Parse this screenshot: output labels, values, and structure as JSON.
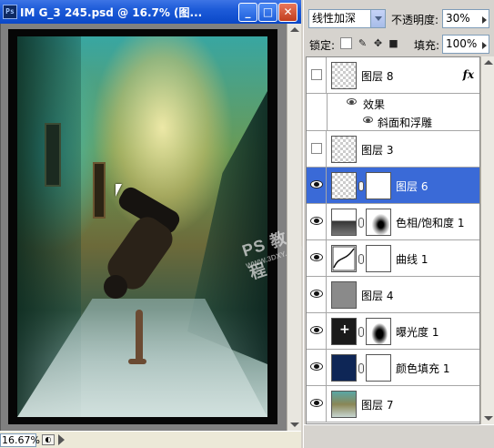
{
  "document": {
    "title": "IM G_3 245.psd @ 16.7% (图...",
    "app_icon": "Ps",
    "buttons": {
      "minimize": "_",
      "maximize": "□",
      "close": "✕"
    },
    "zoom": "16.67%",
    "watermark": "PS 教程",
    "watermark_sub": "WWW.3DXY.COM"
  },
  "layers_panel": {
    "blend_mode": "线性加深",
    "opacity_label": "不透明度:",
    "opacity_value": "30%",
    "lock_label": "锁定:",
    "lock_icons": [
      "lock-transparent-icon",
      "lock-paint-icon",
      "lock-move-icon",
      "lock-all-icon"
    ],
    "fill_label": "填充:",
    "fill_value": "100%",
    "layers": [
      {
        "name": "图层 8",
        "visible": false,
        "thumb": "checker",
        "fx": "fx"
      },
      {
        "name": "效果",
        "sub": true
      },
      {
        "name": "斜面和浮雕",
        "sub": true
      },
      {
        "name": "图层 3",
        "visible": false,
        "thumb": "checker"
      },
      {
        "name": "图层 6",
        "visible": true,
        "thumb": "checker",
        "mask": "mask-white-dot",
        "selected": true
      },
      {
        "name": "色相/饱和度 1",
        "visible": true,
        "thumb": "hue",
        "mask": "mask-cloud"
      },
      {
        "name": "曲线 1",
        "visible": true,
        "thumb": "curves",
        "mask": "mask-white"
      },
      {
        "name": "图层 4",
        "visible": true,
        "thumb": "gray"
      },
      {
        "name": "曝光度 1",
        "visible": true,
        "thumb": "exposure",
        "mask": "mask-dark"
      },
      {
        "name": "颜色填充 1",
        "visible": true,
        "thumb": "navy",
        "mask": "mask-white"
      },
      {
        "name": "图层 7",
        "visible": true,
        "thumb": "photo-t"
      }
    ]
  },
  "colors": {
    "selection": "#3a6ad7",
    "titlebar": "#1d5bd8",
    "fill_layer": "#0e2656"
  }
}
